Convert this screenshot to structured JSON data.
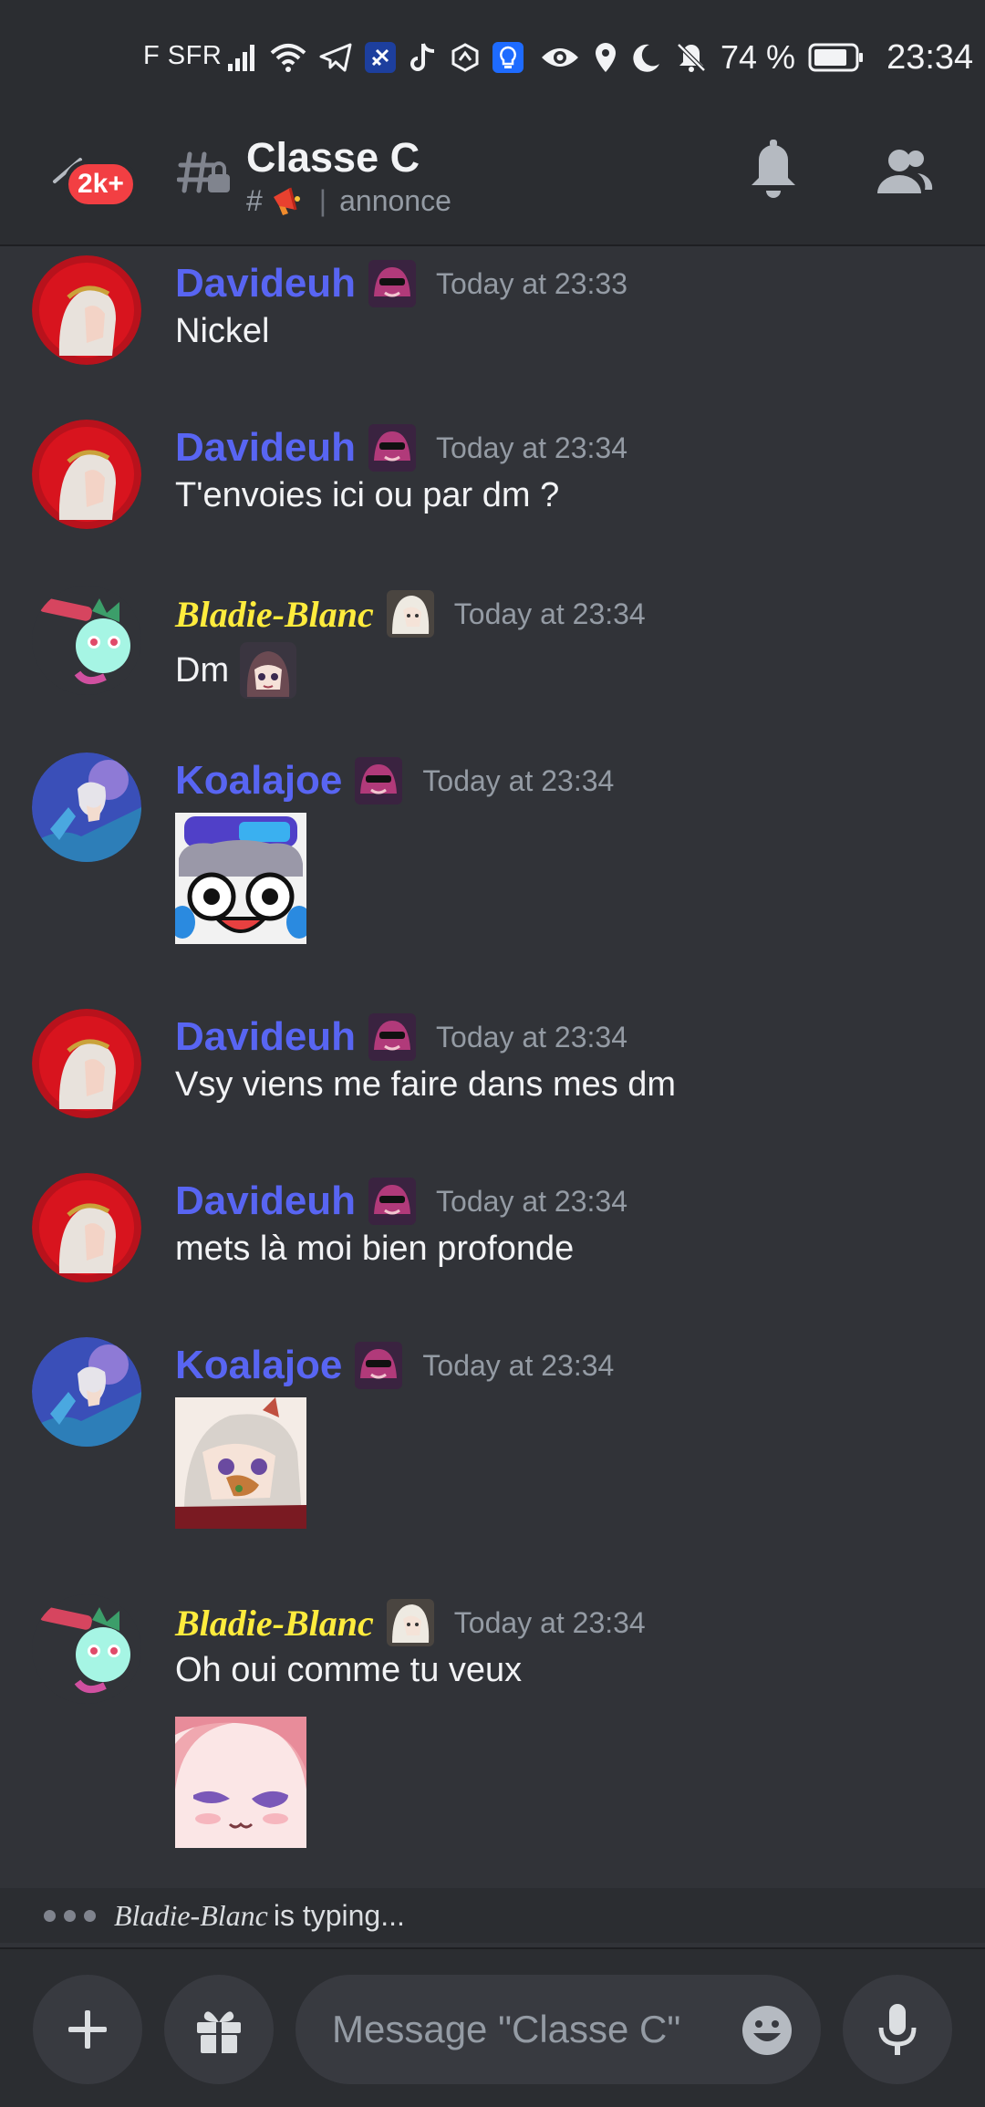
{
  "status_bar": {
    "carrier": "F SFR",
    "battery_percent": "74 %",
    "time": "23:34",
    "icons": [
      "signal-icon",
      "wifi-icon",
      "telegram-icon",
      "app-icon",
      "tiktok-icon",
      "app-icon",
      "bulb-app-icon",
      "eye-icon",
      "location-icon",
      "moon-icon",
      "bell-off-icon",
      "battery-icon"
    ]
  },
  "header": {
    "unread_badge": "2k+",
    "channel_name": "Classe C",
    "channel_prefix": "#",
    "channel_topic": "annonce"
  },
  "messages": [
    {
      "author": "Davideuh",
      "timestamp": "Today at 23:33",
      "text": "Nickel"
    },
    {
      "author": "Davideuh",
      "timestamp": "Today at 23:34",
      "text": "T'envoies ici ou par dm ?"
    },
    {
      "author": "Bladie-Blanc",
      "timestamp": "Today at 23:34",
      "text": "Dm"
    },
    {
      "author": "Koalajoe",
      "timestamp": "Today at 23:34",
      "text": ""
    },
    {
      "author": "Davideuh",
      "timestamp": "Today at 23:34",
      "text": "Vsy viens me faire dans mes dm"
    },
    {
      "author": "Davideuh",
      "timestamp": "Today at 23:34",
      "text": "mets là moi bien profonde"
    },
    {
      "author": "Koalajoe",
      "timestamp": "Today at 23:34",
      "text": ""
    },
    {
      "author": "Bladie-Blanc",
      "timestamp": "Today at 23:34",
      "text": "Oh oui comme tu veux"
    }
  ],
  "typing": {
    "user": "Bladie-Blanc",
    "suffix": "is typing..."
  },
  "composer": {
    "placeholder": "Message \"Classe C\""
  },
  "colors": {
    "background": "#313338",
    "bar": "#2b2d31",
    "username_blue": "#5865f2",
    "username_yellow": "#ffec3d",
    "timestamp": "#949ba4",
    "badge_red": "#f23f43"
  }
}
